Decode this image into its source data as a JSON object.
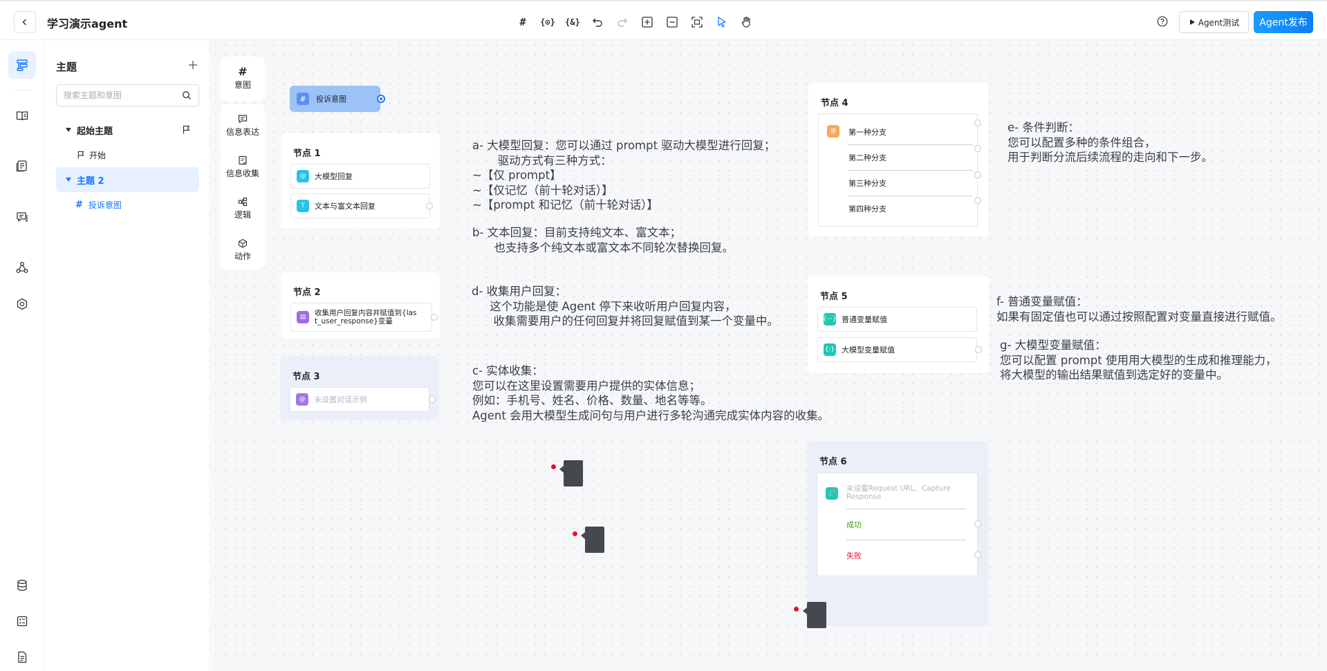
{
  "header": {
    "title": "学习演示agent",
    "toolbar": {
      "hash": "#",
      "var1": "{⊙}",
      "var2": "{&}"
    },
    "agent_test_label": "Agent测试",
    "publish_label": "Agent发布"
  },
  "rail": {
    "icons": [
      "flow-icon",
      "book-icon",
      "document-icon",
      "chat-icon",
      "network-icon",
      "settings-icon",
      "database-icon",
      "checklist-icon",
      "file-icon"
    ]
  },
  "topics": {
    "title": "主题",
    "search_placeholder": "搜索主题和意图",
    "tree": [
      {
        "label": "起始主题",
        "children": [
          {
            "label": "开始"
          }
        ]
      },
      {
        "label": "主题 2",
        "children": [
          {
            "label": "投诉意图"
          }
        ]
      }
    ]
  },
  "palette": {
    "items": [
      {
        "icon": "#",
        "label": "意图"
      },
      {
        "label": "信息表达"
      },
      {
        "label": "信息收集"
      },
      {
        "label": "逻辑"
      },
      {
        "label": "动作"
      }
    ]
  },
  "canvas": {
    "intent": {
      "icon": "#",
      "label": "投诉意图"
    },
    "node1": {
      "title": "节点 1",
      "items": [
        {
          "icon": "@",
          "label": "大模型回复"
        },
        {
          "icon": "T",
          "label": "文本与富文本回复"
        }
      ]
    },
    "node2": {
      "title": "节点 2",
      "item_line1": "收集用户回复内容并赋值到{las",
      "item_line2": "t_user_response}变量"
    },
    "node3": {
      "title": "节点 3",
      "icon": "@",
      "placeholder": "未设置对话示例"
    },
    "node4": {
      "title": "节点 4",
      "branches": [
        "第一种分支",
        "第二种分支",
        "第三种分支",
        "第四种分支"
      ]
    },
    "node5": {
      "title": "节点 5",
      "items": [
        {
          "icon": "{···}",
          "label": "普通变量赋值"
        },
        {
          "icon": "{⁝}",
          "label": "大模型变量赋值"
        }
      ]
    },
    "node6": {
      "title": "节点 6",
      "placeholder_line1": "未设置Request URL、Capture",
      "placeholder_line2": "Response",
      "success": "成功",
      "fail": "失败"
    },
    "annotations": {
      "a": "a- 大模型回复：您可以通过 prompt 驱动大模型进行回复；\n       驱动方式有三种方式：\n~【仅 prompt】\n~【仅记忆（前十轮对话）】\n~【prompt 和记忆（前十轮对话）】",
      "b": "b- 文本回复：目前支持纯文本、富文本；\n      也支持多个纯文本或富文本不同轮次替换回复。",
      "d": "d- 收集用户回复：\n     这个功能是使 Agent 停下来收听用户回复内容，\n      收集需要用户的任何回复并将回复赋值到某一个变量中。",
      "c": "c- 实体收集：\n您可以在这里设置需要用户提供的实体信息；\n例如：手机号、姓名、价格、数量、地名等等。\nAgent 会用大模型生成问句与用户进行多轮沟通完成实体内容的收集。",
      "e": "e- 条件判断：\n您可以配置多种的条件组合，\n用于判断分流后续流程的走向和下一步。",
      "f": "f- 普通变量赋值：\n如果有固定值也可以通过按照配置对变量直接进行赋值。",
      "g": "g- 大模型变量赋值：\n您可以配置 prompt 使用用大模型的生成和推理能力，\n将大模型的输出结果赋值到选定好的变量中。"
    }
  },
  "colors": {
    "accent": "#1677ff",
    "intent_bg": "#9cc2f6",
    "node_lavender": "#eceef8",
    "success": "#389e0d",
    "fail": "#e8112d"
  }
}
